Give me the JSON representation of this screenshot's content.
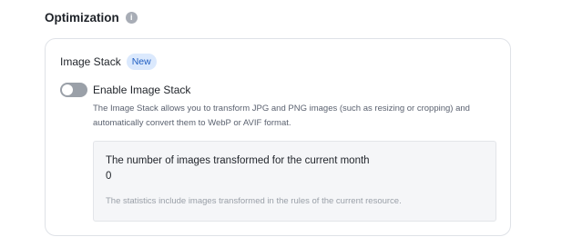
{
  "section": {
    "title": "Optimization",
    "info_icon": "info-icon"
  },
  "card": {
    "name": "Image Stack",
    "badge": "New",
    "toggle": {
      "label": "Enable Image Stack",
      "enabled": false
    },
    "description_line1": "The Image Stack allows you to transform JPG and PNG images (such as resizing or cropping) and",
    "description_line2": "automatically convert them to WebP or AVIF format.",
    "stats": {
      "label": "The number of images transformed for the current month",
      "value": "0",
      "note": "The statistics include images transformed in the rules of the current resource."
    }
  },
  "colors": {
    "badge_bg": "#dbe9fd",
    "badge_text": "#1f5ec2",
    "toggle_off": "#9aa0a8"
  }
}
